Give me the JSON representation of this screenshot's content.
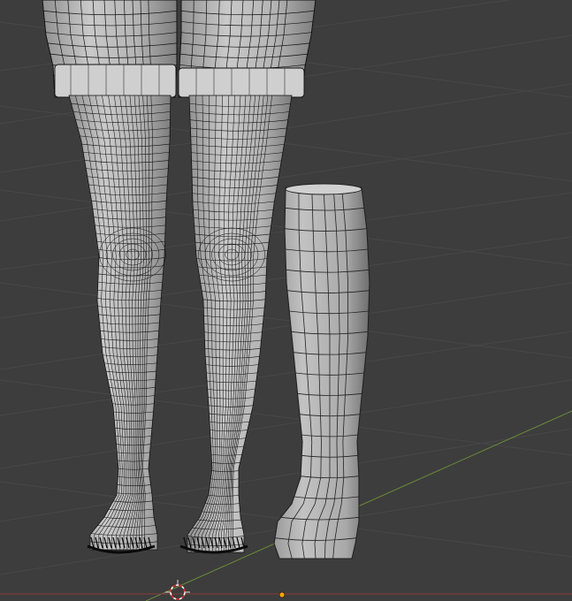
{
  "app": "3D viewport",
  "viewport": {
    "background": "#3d3d3d",
    "grid_color": "#474747",
    "x_axis_color": "#8a3a3a",
    "y_axis_color": "#6b8a3a",
    "mode": "edit-mode-wireframe-overlay"
  },
  "objects": [
    {
      "name": "legs-mesh",
      "shading": "solid-grey",
      "wire_color": "#111111",
      "surface_color": "#b9b9b9"
    },
    {
      "name": "boot-mesh",
      "shading": "solid-grey",
      "wire_color": "#222222",
      "surface_color": "#b0b0b0"
    }
  ],
  "overlays": {
    "cursor_icon": "3d-cursor-icon",
    "origin_icon": "object-origin-icon",
    "origin_color": "#ffa500"
  }
}
